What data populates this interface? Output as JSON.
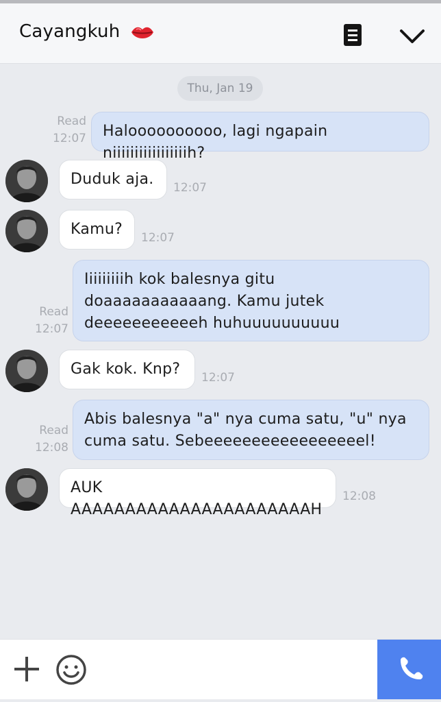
{
  "header": {
    "title": "Cayangkuh",
    "title_emoji": "lips-icon",
    "menu_icon": "menu-list-icon",
    "collapse_icon": "chevron-down-icon"
  },
  "chat": {
    "date_label": "Thu, Jan 19",
    "messages": [
      {
        "direction": "out",
        "status": "Read",
        "time": "12:07",
        "lines": [
          "Haloooooooooo, lagi ngapain niiiiiiiiiiiiiiiiih?"
        ]
      },
      {
        "direction": "in",
        "time": "12:07",
        "lines": [
          "Duduk aja."
        ]
      },
      {
        "direction": "in",
        "time": "12:07",
        "lines": [
          "Kamu?"
        ]
      },
      {
        "direction": "out",
        "status": "Read",
        "time": "12:07",
        "lines": [
          "Iiiiiiiiih kok balesnya gitu",
          "doaaaaaaaaaaang. Kamu jutek",
          "deeeeeeeeeeeh huhuuuuuuuuuu"
        ]
      },
      {
        "direction": "in",
        "time": "12:07",
        "lines": [
          "Gak kok. Knp?"
        ]
      },
      {
        "direction": "out",
        "status": "Read",
        "time": "12:08",
        "lines": [
          "Abis balesnya \"a\" nya cuma satu, \"u\" nya",
          "cuma satu. Sebeeeeeeeeeeeeeeeeel!"
        ]
      },
      {
        "direction": "in",
        "time": "12:08",
        "lines": [
          "AUK AAAAAAAAAAAAAAAAAAAAAAH"
        ]
      }
    ]
  },
  "input_bar": {
    "add_icon": "plus-icon",
    "emoji_icon": "smiley-icon",
    "call_icon": "phone-icon"
  },
  "colors": {
    "accent": "#4f82ef",
    "outgoing_bubble": "#d7e3f7",
    "incoming_bubble": "#ffffff",
    "background": "#e9ebef"
  }
}
